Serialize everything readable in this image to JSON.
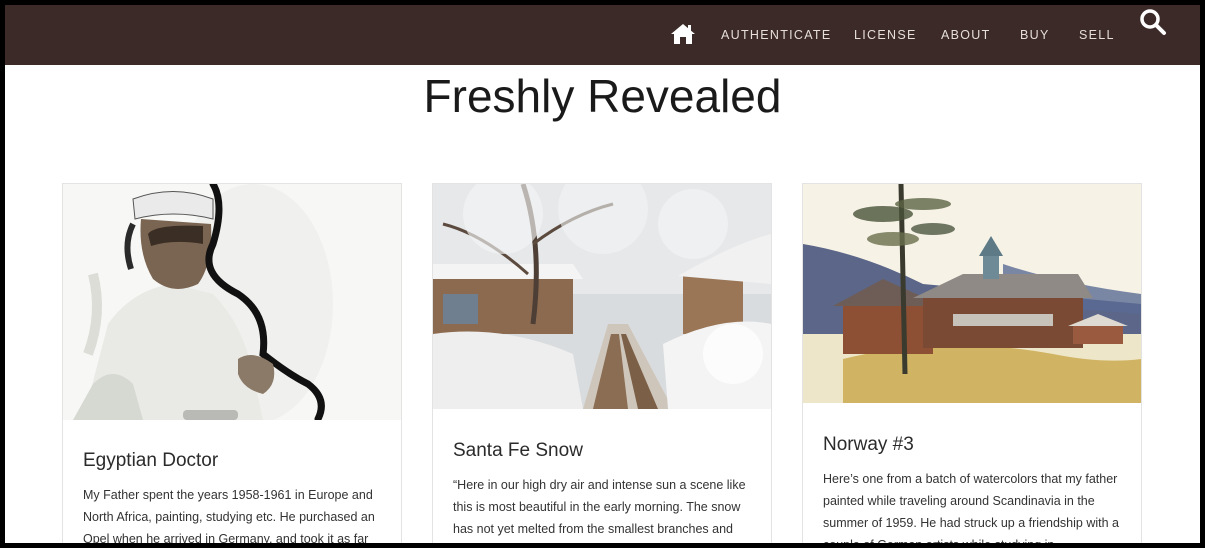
{
  "nav": {
    "home_icon": "home-icon",
    "items": [
      "AUTHENTICATE",
      "LICENSE",
      "ABOUT",
      "BUY",
      "SELL"
    ],
    "search_icon": "search-icon",
    "colors": {
      "bar": "#3b2a27",
      "text": "#e6ded9"
    }
  },
  "page": {
    "title": "Freshly Revealed"
  },
  "cards": [
    {
      "title": "Egyptian Doctor",
      "text": "My Father spent the years 1958-1961 in Europe and North Africa, painting, studying etc. He purchased an Opel when he arrived in Germany, and took it as far"
    },
    {
      "title": "Santa Fe Snow",
      "text": "“Here in our high dry air and intense sun a scene like this is most beautiful in the early morning. The snow has not yet melted from the smallest branches and"
    },
    {
      "title": "Norway #3",
      "text": "Here’s one from a batch of watercolors that my father painted while traveling around Scandinavia in the summer of 1959. He had struck up a friendship with a couple of German artists while studying in"
    }
  ]
}
